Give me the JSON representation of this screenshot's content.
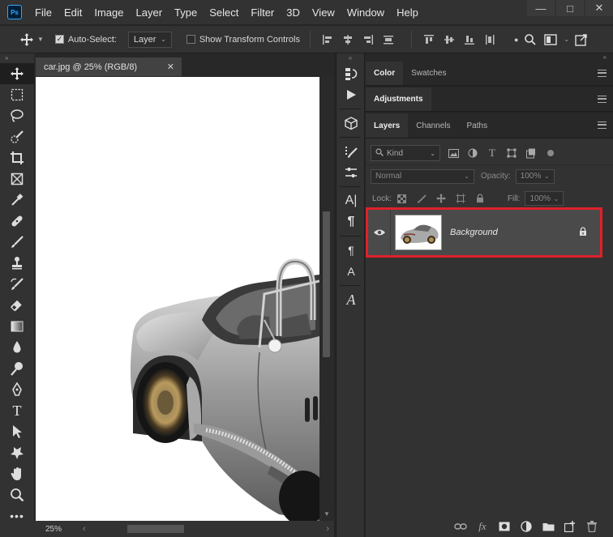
{
  "menubar": {
    "logo": "Ps",
    "items": [
      "File",
      "Edit",
      "Image",
      "Layer",
      "Type",
      "Select",
      "Filter",
      "3D",
      "View",
      "Window",
      "Help"
    ],
    "window_controls": [
      "minimize-icon",
      "maximize-icon",
      "close-icon"
    ]
  },
  "options": {
    "auto_select_label": "Auto-Select:",
    "auto_select_checked": true,
    "auto_select_target": "Layer",
    "show_transform_label": "Show Transform Controls",
    "show_transform_checked": false
  },
  "tools": [
    "move",
    "marquee",
    "lasso",
    "quick-select",
    "crop",
    "frame",
    "eyedropper",
    "healing",
    "brush",
    "clone-stamp",
    "history-brush",
    "eraser",
    "gradient",
    "blur",
    "dodge",
    "pen",
    "type",
    "path-select",
    "shape",
    "hand",
    "zoom",
    "more"
  ],
  "document": {
    "tab_title": "car.jpg @ 25% (RGB/8)",
    "zoom": "25%"
  },
  "panels": {
    "color_tabs": [
      "Color",
      "Swatches"
    ],
    "adjustments_tab": "Adjustments",
    "layer_tabs": [
      "Layers",
      "Channels",
      "Paths"
    ],
    "filter_kind": "Kind",
    "blend_mode": "Normal",
    "opacity_label": "Opacity:",
    "opacity_value": "100%",
    "lock_label": "Lock:",
    "fill_label": "Fill:",
    "fill_value": "100%",
    "layers": [
      {
        "name": "Background",
        "visible": true,
        "locked": true
      }
    ]
  },
  "colors": {
    "highlight": "#e0202a",
    "accent": "#31a8ff"
  }
}
